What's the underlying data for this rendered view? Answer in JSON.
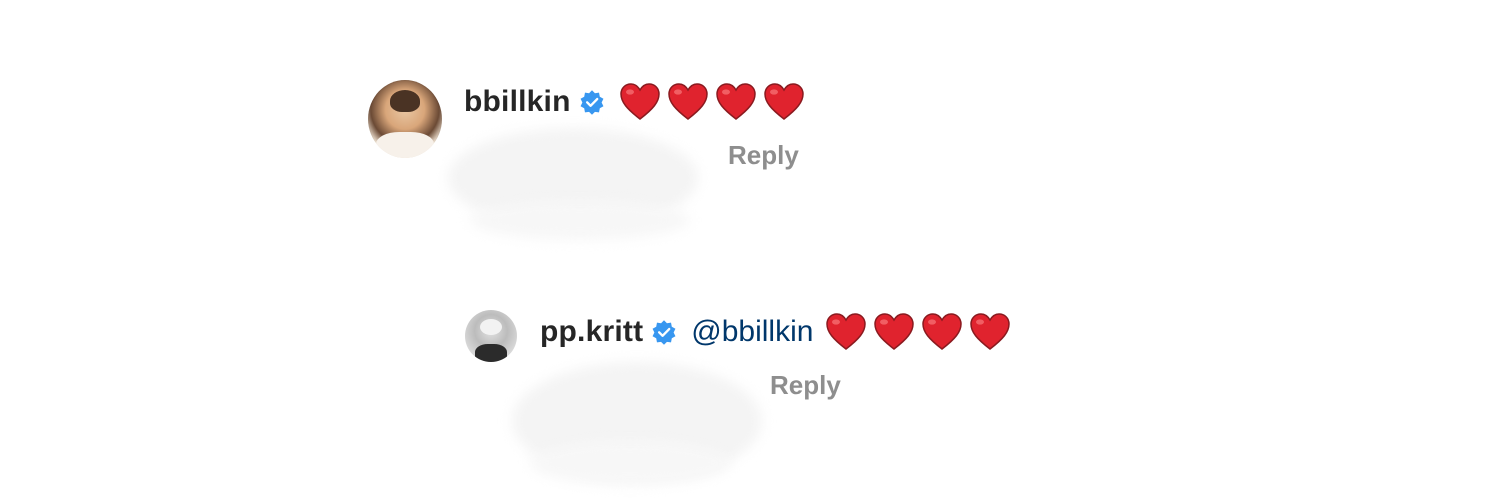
{
  "comments": [
    {
      "username": "bbillkin",
      "verified": true,
      "mention": "",
      "hearts": [
        "red-heart",
        "red-heart",
        "red-heart",
        "red-heart"
      ],
      "reply_label": "Reply"
    },
    {
      "username": "pp.kritt",
      "verified": true,
      "mention": "@bbillkin",
      "hearts": [
        "red-heart",
        "red-heart",
        "red-heart",
        "red-heart"
      ],
      "reply_label": "Reply"
    }
  ],
  "colors": {
    "username": "#262626",
    "mention": "#00376b",
    "reply": "#8e8e8e",
    "verified_badge": "#3897f0",
    "heart": "#e0232e"
  }
}
